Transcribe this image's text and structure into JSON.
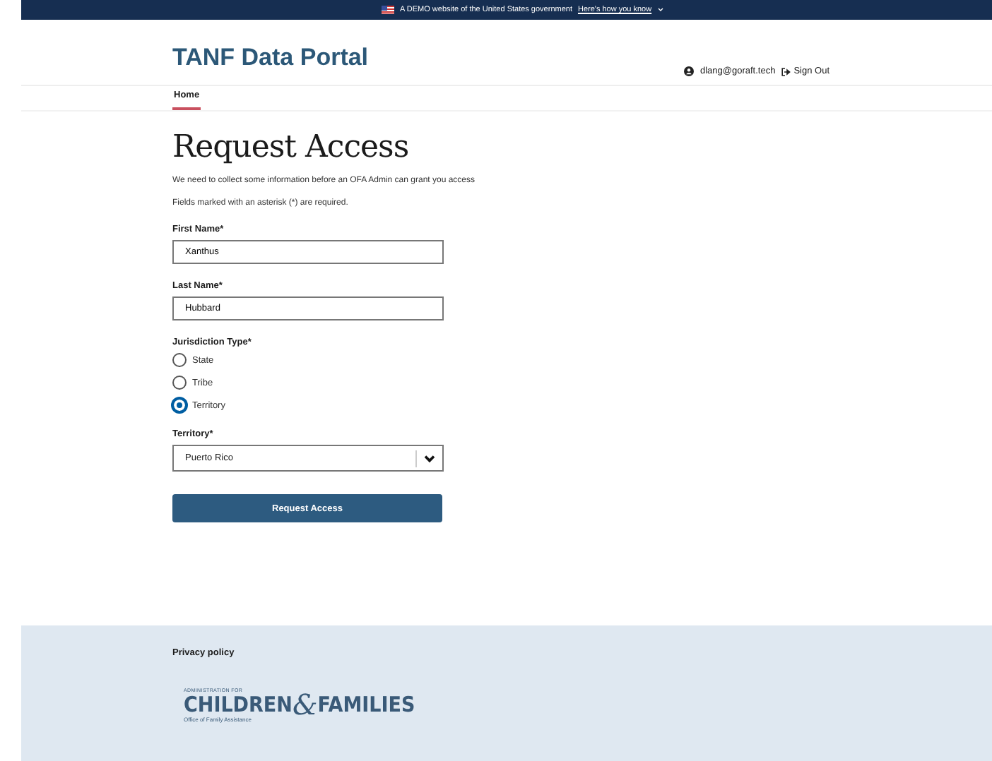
{
  "banner": {
    "text": "A DEMO website of the United States government",
    "link": "Here's how you know"
  },
  "header": {
    "title": "TANF Data Portal",
    "user_email": "dlang@goraft.tech",
    "sign_out": "Sign Out"
  },
  "nav": [
    {
      "label": "Home",
      "selected": true
    }
  ],
  "page": {
    "heading": "Request Access",
    "intro": "We need to collect some information before an OFA Admin can grant you access",
    "required_note": "Fields marked with an asterisk (*) are required."
  },
  "fields": [
    {
      "label": "First Name*",
      "value": "Xanthus"
    },
    {
      "label": "Last Name*",
      "value": "Hubbard"
    }
  ],
  "jurisdiction": {
    "label": "Jurisdiction Type*",
    "options": [
      {
        "label": "State",
        "selected": false
      },
      {
        "label": "Tribe",
        "selected": false
      },
      {
        "label": "Territory",
        "selected": true
      }
    ]
  },
  "territory": {
    "label": "Territory*",
    "value": "Puerto Rico"
  },
  "submit": "Request Access",
  "footer": {
    "link": "Privacy policy",
    "logo": {
      "top": "ADMINISTRATION FOR",
      "left": "CHILDREN",
      "amp": "&",
      "right": "FAMILIES",
      "sub": "Office of Family Assistance"
    }
  }
}
